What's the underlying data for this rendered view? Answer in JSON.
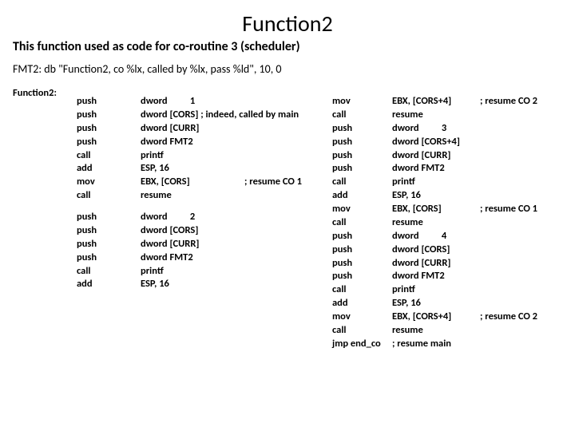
{
  "title": "Function2",
  "subtitle": "This function used as code for co-routine 3 (scheduler)",
  "fmt": "FMT2: db \"Function2, co %lx, called by %lx, pass %ld\", 10, 0",
  "label": "Function2:",
  "left_block1": {
    "instr": "push\npush\npush\npush\ncall\nadd\nmov\ncall",
    "ops": "dword          1\ndword [CORS] ; indeed, called by main\ndword [CURR]\ndword FMT2\nprintf\nESP, 16\nEBX, [CORS]\nresume",
    "comm": "\n\n\n\n\n\n; resume CO 1\n"
  },
  "left_block2": {
    "instr": "push\npush\npush\npush\ncall\nadd",
    "ops": "dword          2\ndword [CORS]\ndword [CURR]\ndword FMT2\nprintf\nESP, 16"
  },
  "right": {
    "instr": "mov\ncall\npush\npush\npush\npush\ncall\nadd\nmov\ncall\npush\npush\npush\npush\ncall\nadd\nmov\ncall\njmp end_co",
    "ops": "EBX, [CORS+4]\nresume\ndword          3\ndword [CORS+4]\ndword [CURR]\ndword FMT2\nprintf\nESP, 16\nEBX, [CORS]\nresume\ndword          4\ndword [CORS]\ndword [CURR]\ndword FMT2\nprintf\nESP, 16\nEBX, [CORS+4]\nresume\n; resume main",
    "comm": "; resume CO 2\n\n\n\n\n\n\n\n; resume CO 1\n\n\n\n\n\n\n\n; resume CO 2\n\n"
  }
}
